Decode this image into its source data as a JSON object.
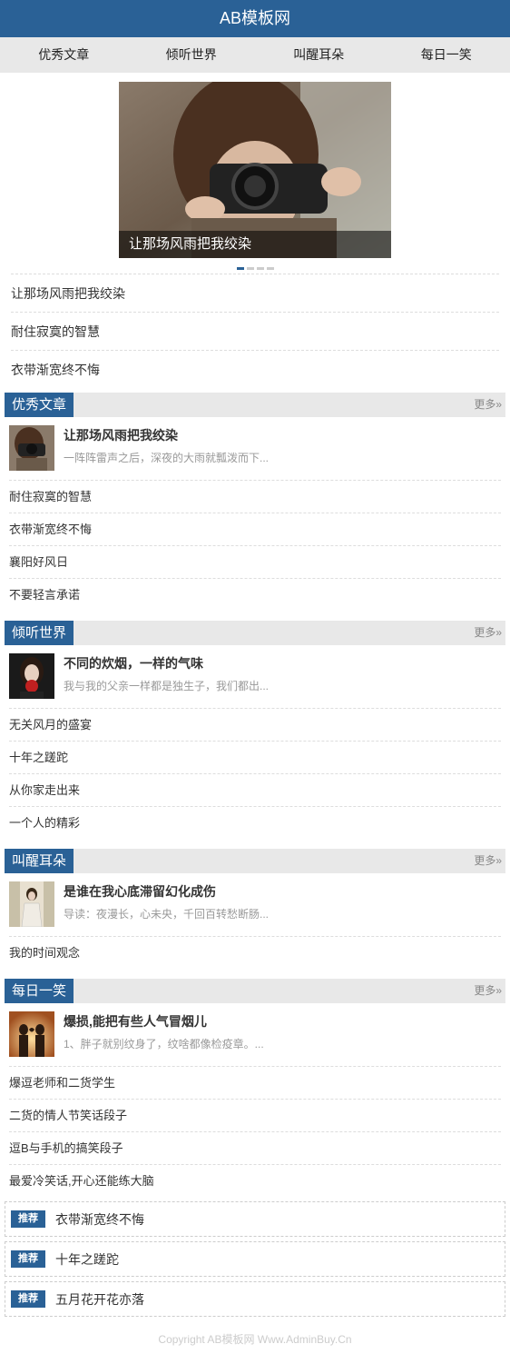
{
  "header": {
    "title": "AB模板网"
  },
  "nav": {
    "items": [
      "优秀文章",
      "倾听世界",
      "叫醒耳朵",
      "每日一笑"
    ]
  },
  "slider": {
    "caption": "让那场风雨把我绞染",
    "dot_count": 4,
    "active_index": 0
  },
  "slide_list": [
    "让那场风雨把我绞染",
    "耐住寂寞的智慧",
    "衣带渐宽终不悔"
  ],
  "sections": [
    {
      "title": "优秀文章",
      "more": "更多»",
      "feature": {
        "title": "让那场风雨把我绞染",
        "desc": "一阵阵雷声之后，深夜的大雨就瓢泼而下..."
      },
      "items": [
        "耐住寂寞的智慧",
        "衣带渐宽终不悔",
        "襄阳好风日",
        "不要轻言承诺"
      ]
    },
    {
      "title": "倾听世界",
      "more": "更多»",
      "feature": {
        "title": "不同的炊烟，一样的气味",
        "desc": "我与我的父亲一样都是独生子，我们都出..."
      },
      "items": [
        "无关风月的盛宴",
        "十年之蹉跎",
        "从你家走出来",
        "一个人的精彩"
      ]
    },
    {
      "title": "叫醒耳朵",
      "more": "更多»",
      "feature": {
        "title": "是谁在我心底滞留幻化成伤",
        "desc": "导读：夜漫长，心未央，千回百转愁断肠..."
      },
      "items": [
        "我的时间观念"
      ]
    },
    {
      "title": "每日一笑",
      "more": "更多»",
      "feature": {
        "title": "爆损,能把有些人气冒烟儿",
        "desc": "1、胖子就别纹身了，纹啥都像检疫章。..."
      },
      "items": [
        "爆逗老师和二货学生",
        "二货的情人节笑话段子",
        "逗B与手机的搞笑段子",
        "最爱冷笑话,开心还能练大脑"
      ]
    }
  ],
  "recommend": {
    "badge": "推荐",
    "items": [
      "衣带渐宽终不悔",
      "十年之蹉跎",
      "五月花开花亦落"
    ]
  },
  "footer": {
    "text": "Copyright AB模板网 Www.AdminBuy.Cn"
  }
}
